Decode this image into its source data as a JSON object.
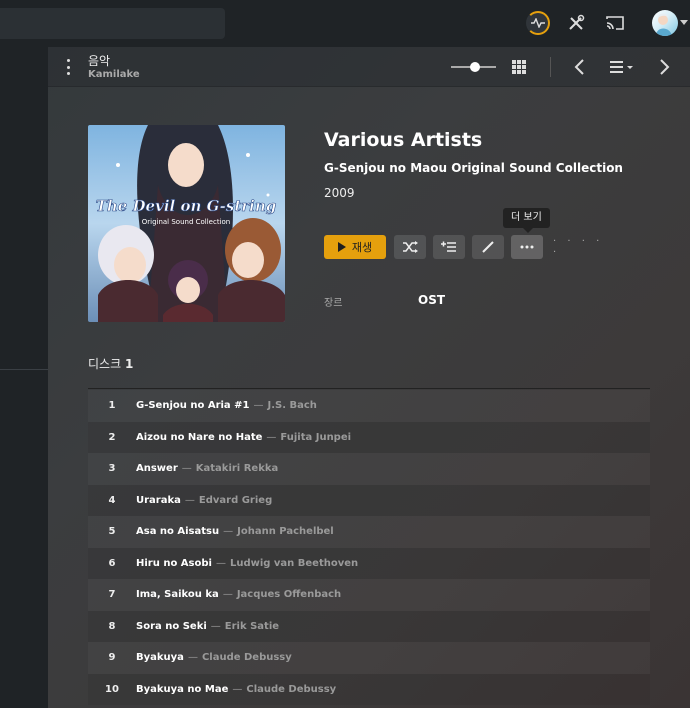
{
  "header": {
    "title": "음악",
    "subtitle": "Kamilake"
  },
  "album": {
    "artist": "Various Artists",
    "title": "G-Senjou no Maou Original Sound Collection",
    "year": "2009",
    "play_label": "재생",
    "more_tooltip": "더 보기",
    "overflow_dots": "· · · · ·",
    "genre_label": "장르",
    "genre_value": "OST",
    "disc_prefix": "디스크",
    "disc_number": "1",
    "cover_text_line1": "The Devil on G-string",
    "cover_text_line2": "Original Sound Collection"
  },
  "tracks": [
    {
      "num": "1",
      "title": "G-Senjou no Aria #1",
      "artist": "J.S. Bach"
    },
    {
      "num": "2",
      "title": "Aizou no Nare no Hate",
      "artist": "Fujita Junpei"
    },
    {
      "num": "3",
      "title": "Answer",
      "artist": "Katakiri Rekka"
    },
    {
      "num": "4",
      "title": "Uraraka",
      "artist": "Edvard Grieg"
    },
    {
      "num": "5",
      "title": "Asa no Aisatsu",
      "artist": "Johann Pachelbel"
    },
    {
      "num": "6",
      "title": "Hiru no Asobi",
      "artist": "Ludwig van Beethoven"
    },
    {
      "num": "7",
      "title": "Ima, Saikou ka",
      "artist": "Jacques Offenbach"
    },
    {
      "num": "8",
      "title": "Sora no Seki",
      "artist": "Erik Satie"
    },
    {
      "num": "9",
      "title": "Byakuya",
      "artist": "Claude Debussy"
    },
    {
      "num": "10",
      "title": "Byakuya no Mae",
      "artist": "Claude Debussy"
    }
  ],
  "separator": "—",
  "colors": {
    "accent": "#e5a00d",
    "background": "#1f2326"
  },
  "icons": {
    "activity": "activity-icon",
    "tools": "tools-icon",
    "cast": "cast-icon",
    "grid": "grid-icon",
    "prev": "chevron-left-icon",
    "next": "chevron-right-icon",
    "list": "list-icon",
    "shuffle": "shuffle-icon",
    "queue": "add-to-queue-icon",
    "edit": "pencil-icon",
    "more": "more-icon"
  }
}
